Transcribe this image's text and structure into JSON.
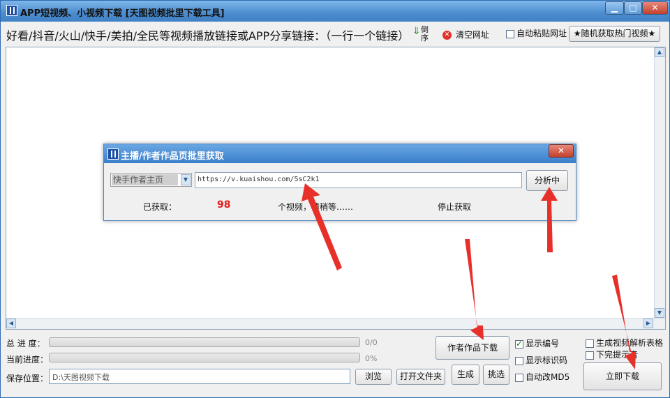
{
  "window": {
    "title": "APP短视频、小视频下载 [天图视频批里下载工具]",
    "min_icon": "minimize-icon",
    "max_icon": "maximize-icon",
    "close_icon": "close-icon"
  },
  "header": {
    "prompt": "好看/抖音/火山/快手/美拍/全民等视频播放链接或APP分享链接：（一行一个链接）",
    "sort_label": "倒序",
    "clear_url": "清空网址",
    "auto_paste": "自动粘贴网址",
    "auto_paste_checked": false,
    "random_hot": "★随机获取热门视频★"
  },
  "dialog": {
    "title": "主播/作者作品页批里获取",
    "source_select": "快手作者主页",
    "url": "https://v.kuaishou.com/5sC2k1",
    "analyze_button": "分析中",
    "fetched_label": "已获取：",
    "fetched_count": "98",
    "fetched_suffix": "个视频，请稍等……",
    "stop_label": "停止获取"
  },
  "progress": {
    "total_label": "总 进 度：",
    "total_value": "0/0",
    "total_fraction": 0,
    "current_label": "当前进度：",
    "current_value": "0%",
    "current_fraction": 0
  },
  "save": {
    "label": "保存位置：",
    "path": "D:\\天图视频下载",
    "browse": "浏览",
    "open_folder": "打开文件夹"
  },
  "actions": {
    "author_download": "作者作品下载",
    "generate": "生成",
    "pick": "挑选",
    "download_now": "立即下载"
  },
  "options": {
    "show_number": "显示编号",
    "show_number_checked": true,
    "show_id_code": "显示标识码",
    "show_id_code_checked": false,
    "auto_md5": "自动改MD5",
    "auto_md5_checked": false,
    "gen_table": "生成视频解析表格",
    "gen_table_checked": false,
    "done_beep": "下完提示音",
    "done_beep_checked": false
  },
  "colors": {
    "count_color": "#e0201c",
    "arrow_color": "#e8302a",
    "title_bar": "#4f8fd0"
  }
}
